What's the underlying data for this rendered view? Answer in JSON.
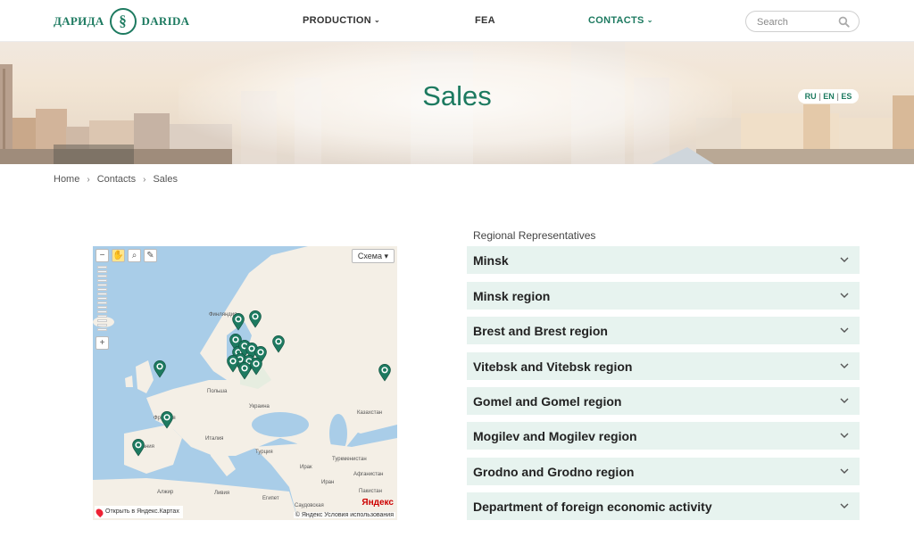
{
  "header": {
    "logo_ru": "ДАРИДА",
    "logo_en": "DARIDA",
    "nav": [
      {
        "label": "PRODUCTION",
        "has_dropdown": true,
        "active": false
      },
      {
        "label": "FEA",
        "has_dropdown": false,
        "active": false
      },
      {
        "label": "CONTACTS",
        "has_dropdown": true,
        "active": true
      }
    ],
    "search_placeholder": "Search"
  },
  "banner": {
    "title": "Sales",
    "languages": [
      "RU",
      "EN",
      "ES"
    ],
    "separator": "|"
  },
  "breadcrumb": [
    "Home",
    "Contacts",
    "Sales"
  ],
  "map": {
    "type_button": "Схема",
    "open_link": "Открыть в Яндекс.Картах",
    "brand": "Яндекс",
    "copyright": "© Яндекс   Условия использования",
    "place_labels": [
      "Финляндия",
      "Польша",
      "Украина",
      "Франция",
      "Испания",
      "Италия",
      "Турция",
      "Казахстан",
      "Алжир",
      "Ливия",
      "Египет",
      "Ирак",
      "Иран",
      "Саудовская",
      "Афганистан",
      "Пакистан",
      "Туркменистан"
    ],
    "icons": [
      "zoom-out-icon",
      "hand-icon",
      "magnifier-icon",
      "ruler-icon",
      "zoom-in-icon"
    ]
  },
  "regional": {
    "heading": "Regional Representatives",
    "items": [
      "Minsk",
      "Minsk region",
      "Brest and Brest region",
      "Vitebsk and Vitebsk region",
      "Gomel and Gomel region",
      "Mogilev and Mogilev region",
      "Grodno and Grodno region",
      "Department of foreign economic activity"
    ]
  },
  "colors": {
    "brand_green": "#1d7a60",
    "accordion_bg": "#e7f3ef",
    "map_water": "#a9cde8",
    "map_land": "#f4efe6"
  }
}
